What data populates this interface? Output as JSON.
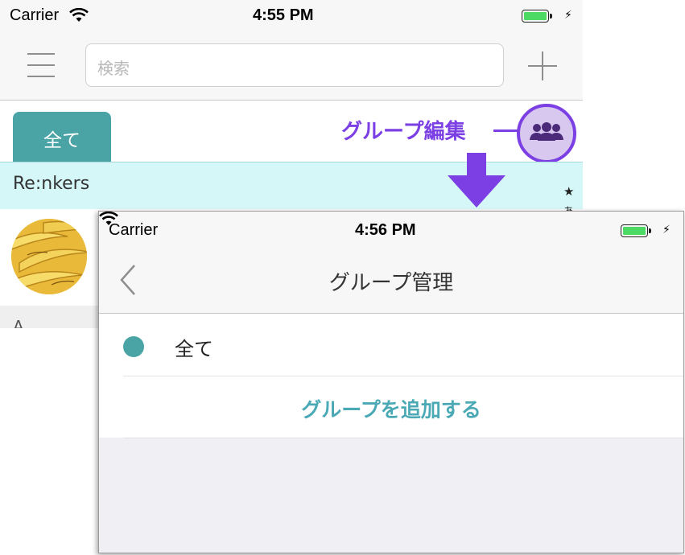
{
  "back_screen": {
    "status": {
      "carrier": "Carrier",
      "time": "4:55 PM"
    },
    "search": {
      "placeholder": "検索"
    },
    "tabs": [
      {
        "label": "全て"
      }
    ],
    "annotation": "グループ編集",
    "group_header": {
      "name": "Re:nkers",
      "star": "★",
      "kana": "あ"
    },
    "section_letter": "A"
  },
  "front_screen": {
    "status": {
      "carrier": "Carrier",
      "time": "4:56 PM"
    },
    "title": "グループ管理",
    "groups": [
      {
        "label": "全て"
      }
    ],
    "add_group_label": "グループを追加する"
  },
  "colors": {
    "accent_teal": "#4aa4a6",
    "annotation_purple": "#7b3fe4",
    "battery_green": "#4cd964",
    "group_header_bg": "#d6f7f8"
  },
  "icons": [
    "wifi-icon",
    "battery-icon",
    "menu-icon",
    "plus-icon",
    "group-icon",
    "down-arrow-icon",
    "back-chevron-icon"
  ]
}
